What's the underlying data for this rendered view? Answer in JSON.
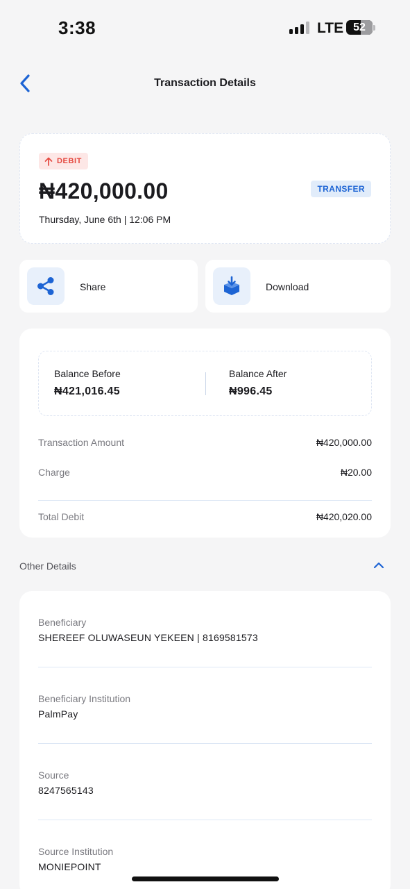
{
  "status_bar": {
    "time": "3:38",
    "network": "LTE",
    "battery": "52",
    "signal_bars": 4,
    "signal_bars_active": 3
  },
  "header": {
    "title": "Transaction Details",
    "back_icon": "chevron-left-icon"
  },
  "summary": {
    "direction_label": "DEBIT",
    "direction_icon": "arrow-up-icon",
    "amount": "₦420,000.00",
    "type_label": "TRANSFER",
    "datetime": "Thursday, June 6th | 12:06 PM"
  },
  "actions": [
    {
      "label": "Share",
      "icon": "share-icon"
    },
    {
      "label": "Download",
      "icon": "download-icon"
    }
  ],
  "balances": {
    "before_label": "Balance Before",
    "before_value": "₦421,016.45",
    "after_label": "Balance After",
    "after_value": "₦996.45"
  },
  "breakdown": [
    {
      "label": "Transaction Amount",
      "value": "₦420,000.00"
    },
    {
      "label": "Charge",
      "value": "₦20.00"
    },
    {
      "label": "Total Debit",
      "value": "₦420,020.00"
    }
  ],
  "other_details": {
    "title": "Other Details",
    "toggle_icon": "chevron-up-icon",
    "items": [
      {
        "label": "Beneficiary",
        "value": "SHEREEF OLUWASEUN YEKEEN | 8169581573"
      },
      {
        "label": "Beneficiary Institution",
        "value": "PalmPay"
      },
      {
        "label": "Source",
        "value": "8247565143"
      },
      {
        "label": "Source Institution",
        "value": "MONIEPOINT"
      }
    ]
  },
  "colors": {
    "accent": "#1d64d4",
    "debit_red": "#e5483f",
    "background": "#f5f5f6",
    "card": "#ffffff"
  }
}
